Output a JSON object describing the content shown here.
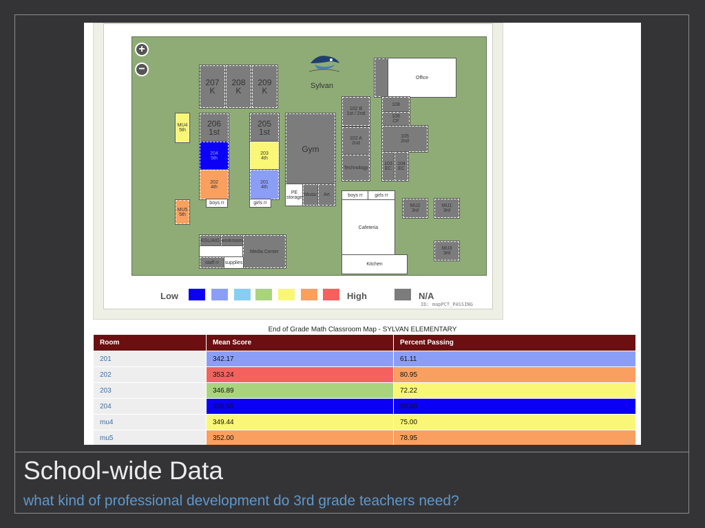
{
  "slide": {
    "title": "School-wide Data",
    "subtitle": "what kind of professional development do 3rd grade teachers need?"
  },
  "map": {
    "zoom_in": "+",
    "zoom_out": "−",
    "school_label": "Sylvan",
    "rooms": {
      "r207": "207\nK",
      "r208": "208\nK",
      "r209": "209\nK",
      "r206": "206\n1st",
      "r205": "205\n1st",
      "mu4": "MU4\n5th",
      "r204": "204\n5th",
      "r203": "203\n4th",
      "r202": "202\n4th",
      "r201": "201\n4th",
      "boys_rr_left": "boys rr",
      "girls_rr_left": "girls rr",
      "mu5": "MU5\n5th",
      "gym": "Gym",
      "pe_storage": "PE\nstorage",
      "music": "Music",
      "art": "Art",
      "r102b": "102 B\n1st / 2nd",
      "r102a": "102 A\n2nd",
      "technology": "Technology",
      "r108": "108",
      "r106": "106\nCF",
      "r105": "105\n2nd",
      "r103": "103\nEC",
      "r104": "104\nEC",
      "office": "Office",
      "boys_rr_right": "boys rr",
      "girls_rr_right": "girls rr",
      "mu2": "MU2\n3rd",
      "mu1": "MU1\n3rd",
      "mu3": "MU3\n3rd",
      "cafeteria": "Cafeteria",
      "kitchen": "Kitchen",
      "esl": "ESL/AIG",
      "workroom": "workroom",
      "media_center": "Media Center",
      "staff_rr": "staff rr",
      "supplies": "supplies"
    },
    "legend": {
      "low": "Low",
      "high": "High",
      "na": "N/A",
      "map_id": "ID: mapPCT_PASSING",
      "scale_colors": [
        "#0b00f5",
        "#8b9ef6",
        "#87cff2",
        "#a9d47e",
        "#f9f775",
        "#f9a060",
        "#f4615f"
      ],
      "na_color": "#7c7c7c"
    }
  },
  "table": {
    "caption": "End of Grade Math Classroom Map - SYLVAN ELEMENTARY",
    "headers": [
      "Room",
      "Mean Score",
      "Percent Passing"
    ],
    "rows": [
      {
        "room": "201",
        "mean": "342.17",
        "pct": "61.11",
        "mean_color": "#8b9ef6",
        "pct_color": "#8b9ef6"
      },
      {
        "room": "202",
        "mean": "353.24",
        "pct": "80.95",
        "mean_color": "#f4615f",
        "pct_color": "#f9a060"
      },
      {
        "room": "203",
        "mean": "346.89",
        "pct": "72.22",
        "mean_color": "#a9d47e",
        "pct_color": "#f9f775"
      },
      {
        "room": "204",
        "mean": "338.50",
        "pct": "50.00",
        "mean_color": "#0b00f5",
        "pct_color": "#0b00f5"
      },
      {
        "room": "mu4",
        "mean": "349.44",
        "pct": "75.00",
        "mean_color": "#f9f775",
        "pct_color": "#f9f775"
      },
      {
        "room": "mu5",
        "mean": "352.00",
        "pct": "78.95",
        "mean_color": "#f9a060",
        "pct_color": "#f9a060"
      }
    ]
  }
}
